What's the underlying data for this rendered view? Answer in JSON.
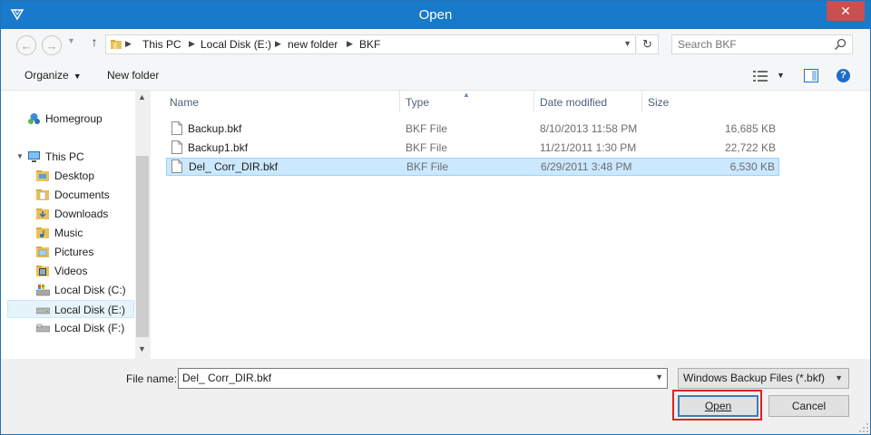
{
  "window": {
    "title": "Open",
    "close_glyph": "✕",
    "accent": "#1979ca",
    "close_color": "#c75050"
  },
  "address": {
    "back_glyph": "←",
    "forward_glyph": "→",
    "up_glyph": "↑",
    "refresh_glyph": "↻",
    "crumbs": [
      "This PC",
      "Local Disk (E:)",
      "new folder",
      "BKF"
    ],
    "search_placeholder": "Search BKF"
  },
  "toolbar": {
    "organize_label": "Organize",
    "new_folder_label": "New folder",
    "help_glyph": "?"
  },
  "nav": {
    "items": [
      {
        "label": "Homegroup",
        "icon": "homegroup-icon"
      },
      {
        "label": "This PC",
        "icon": "computer-icon"
      },
      {
        "label": "Desktop",
        "icon": "folder-icon"
      },
      {
        "label": "Documents",
        "icon": "folder-icon"
      },
      {
        "label": "Downloads",
        "icon": "folder-icon"
      },
      {
        "label": "Music",
        "icon": "folder-icon"
      },
      {
        "label": "Pictures",
        "icon": "folder-icon"
      },
      {
        "label": "Videos",
        "icon": "folder-icon"
      },
      {
        "label": "Local Disk (C:)",
        "icon": "drive-icon"
      },
      {
        "label": "Local Disk (E:)",
        "icon": "drive-icon",
        "selected": true
      },
      {
        "label": "Local Disk (F:)",
        "icon": "drive-icon"
      }
    ]
  },
  "columns": {
    "name": "Name",
    "type": "Type",
    "date": "Date modified",
    "size": "Size"
  },
  "files": [
    {
      "name": "Backup.bkf",
      "type": "BKF File",
      "date": "8/10/2013 11:58 PM",
      "size": "16,685 KB"
    },
    {
      "name": "Backup1.bkf",
      "type": "BKF File",
      "date": "11/21/2011 1:30 PM",
      "size": "22,722 KB"
    },
    {
      "name": "Del_ Corr_DIR.bkf",
      "type": "BKF File",
      "date": "6/29/2011 3:48 PM",
      "size": "6,530 KB",
      "selected": true
    }
  ],
  "footer": {
    "file_name_label": "File name:",
    "file_name_value": "Del_ Corr_DIR.bkf",
    "filter_value": "Windows Backup Files (*.bkf)",
    "open_label": "Open",
    "cancel_label": "Cancel"
  }
}
